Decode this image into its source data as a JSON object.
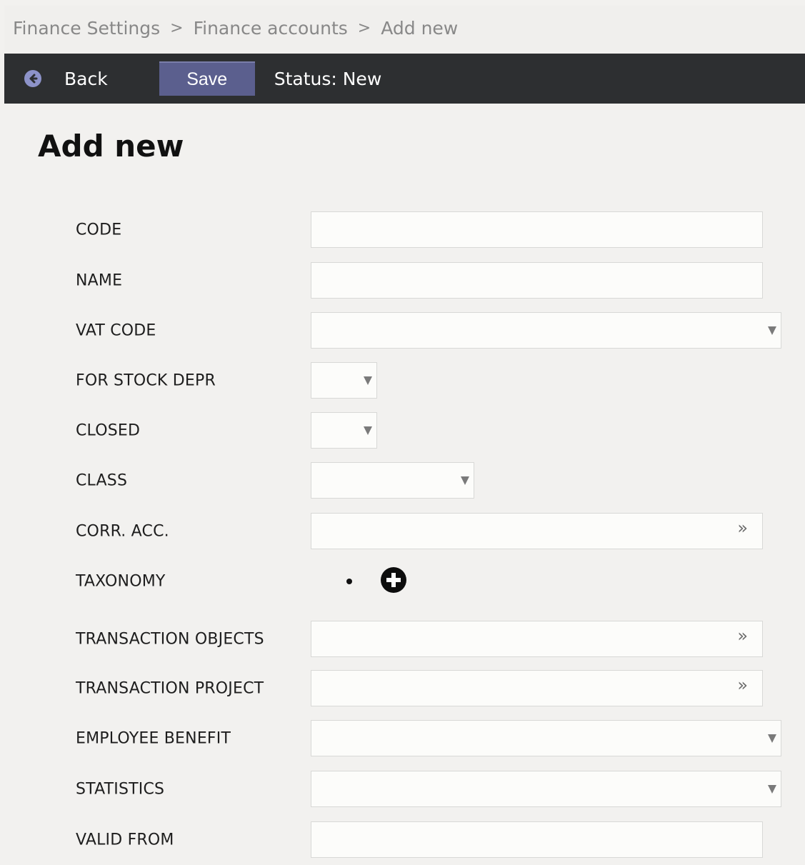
{
  "breadcrumb": {
    "items": [
      "Finance Settings",
      "Finance accounts",
      "Add new"
    ],
    "separator": ">"
  },
  "toolbar": {
    "back_label": "Back",
    "save_label": "Save",
    "status": "Status: New"
  },
  "page_title": "Add new",
  "form": {
    "fields": [
      {
        "label": "CODE",
        "type": "text",
        "value": ""
      },
      {
        "label": "NAME",
        "type": "text",
        "value": ""
      },
      {
        "label": "VAT CODE",
        "type": "select",
        "value": ""
      },
      {
        "label": "FOR STOCK DEPR",
        "type": "select",
        "value": ""
      },
      {
        "label": "CLOSED",
        "type": "select",
        "value": ""
      },
      {
        "label": "CLASS",
        "type": "select",
        "value": ""
      },
      {
        "label": "CORR. ACC.",
        "type": "lookup",
        "value": ""
      },
      {
        "label": "TAXONOMY",
        "type": "list-add"
      },
      {
        "label": "TRANSACTION OBJECTS",
        "type": "lookup",
        "value": ""
      },
      {
        "label": "TRANSACTION PROJECT",
        "type": "lookup",
        "value": ""
      },
      {
        "label": "EMPLOYEE BENEFIT",
        "type": "select",
        "value": ""
      },
      {
        "label": "STATISTICS",
        "type": "select",
        "value": ""
      },
      {
        "label": "VALID FROM",
        "type": "text",
        "value": ""
      }
    ]
  },
  "icons": {
    "back": "arrow-left-circle-icon",
    "lookup": "double-chevron-right-icon",
    "add": "plus-circle-icon",
    "caret": "caret-down-icon"
  },
  "colors": {
    "toolbar_bg": "#2d2f31",
    "save_button_bg": "#5b5f8e",
    "back_icon": "#8d93c9",
    "page_bg": "#f2f1ef"
  }
}
